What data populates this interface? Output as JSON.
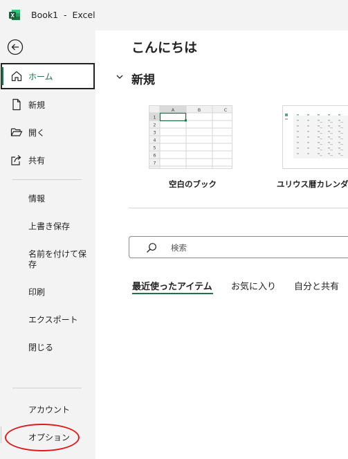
{
  "window": {
    "title": "Book1  -  Excel"
  },
  "nav": {
    "home": "ホーム",
    "new": "新規",
    "open": "開く",
    "share": "共有",
    "info": "情報",
    "save": "上書き保存",
    "save_as": "名前を付けて保存",
    "print": "印刷",
    "export": "エクスポート",
    "close": "閉じる",
    "account": "アカウント",
    "options": "オプション"
  },
  "main": {
    "greeting": "こんにちは",
    "new_section": "新規",
    "templates": [
      {
        "label": "空白のブック"
      },
      {
        "label": "ユリウス暦カレンダー"
      }
    ],
    "blank_grid": {
      "columns": [
        "A",
        "B",
        "C"
      ],
      "rows": [
        "1",
        "2",
        "3",
        "4",
        "5",
        "6",
        "7"
      ]
    },
    "search_placeholder": "検索",
    "tabs": [
      "最近使ったアイテム",
      "お気に入り",
      "自分と共有"
    ]
  },
  "colors": {
    "accent": "#1e7145",
    "annotation": "#e0191b"
  }
}
